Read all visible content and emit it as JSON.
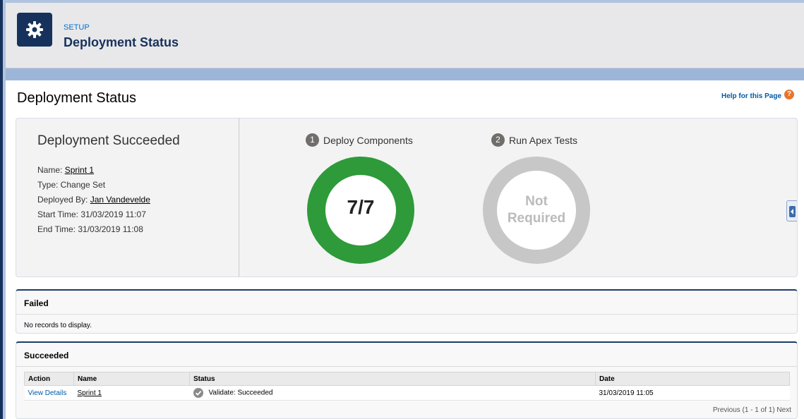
{
  "header": {
    "crumb": "SETUP",
    "title": "Deployment Status",
    "icon": "gear-icon"
  },
  "page": {
    "title": "Deployment Status",
    "help_link": "Help for this Page",
    "help_icon": "?"
  },
  "summary": {
    "title": "Deployment Succeeded",
    "name_label": "Name: ",
    "name_value": "Sprint 1",
    "type": "Type: Change Set",
    "deployed_by_label": "Deployed By: ",
    "deployed_by_value": "Jan Vandevelde",
    "start_time": "Start Time: 31/03/2019 11:07",
    "end_time": "End Time: 31/03/2019 11:08"
  },
  "steps": [
    {
      "number": "1",
      "label": "Deploy Components",
      "ring_text": "7/7",
      "progress": 1.0,
      "color": "#2e9a3a"
    },
    {
      "number": "2",
      "label": "Run Apex Tests",
      "ring_line1": "Not",
      "ring_line2": "Required",
      "color": "#c7c7c7"
    }
  ],
  "failed": {
    "title": "Failed",
    "empty_text": "No records to display."
  },
  "succeeded": {
    "title": "Succeeded",
    "columns": [
      "Action",
      "Name",
      "Status",
      "Date"
    ],
    "rows": [
      {
        "action": "View Details",
        "name": "Sprint 1",
        "status": "Validate: Succeeded",
        "date": "31/03/2019 11:05"
      }
    ],
    "pager": "Previous (1 - 1 of 1) Next"
  }
}
